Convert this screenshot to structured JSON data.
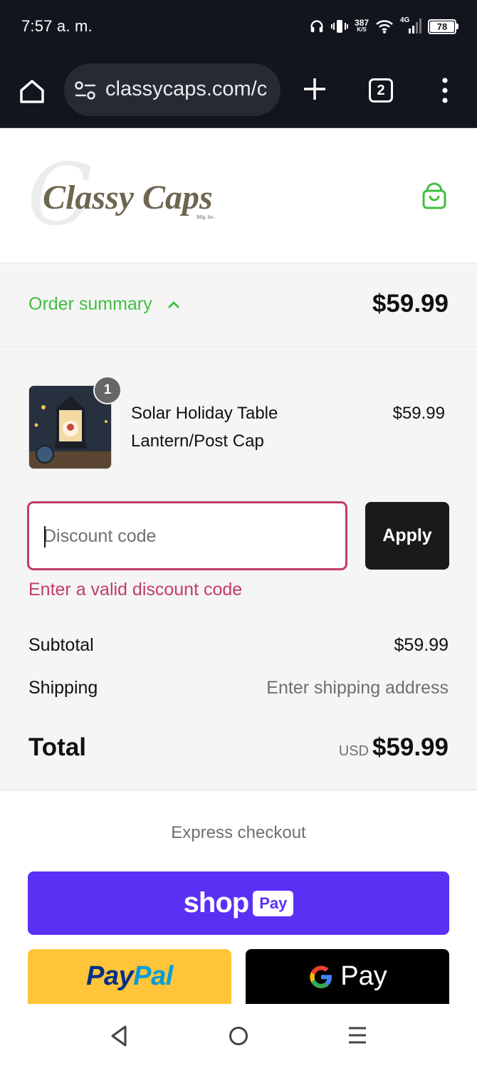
{
  "status_bar": {
    "time": "7:57 a. m.",
    "net_speed_value": "387",
    "net_speed_unit": "K/S",
    "network_type": "4G",
    "battery": "78"
  },
  "browser": {
    "url": "classycaps.com/c",
    "tab_count": "2"
  },
  "header": {
    "logo_text": "Classy Caps",
    "logo_subtext": "Mfg. Inc."
  },
  "summary": {
    "toggle_label": "Order summary",
    "toggle_total": "$59.99",
    "item": {
      "name": "Solar Holiday Table Lantern/Post Cap",
      "price": "$59.99",
      "quantity": "1"
    },
    "discount": {
      "placeholder": "Discount code",
      "apply_label": "Apply",
      "error": "Enter a valid discount code"
    },
    "subtotal_label": "Subtotal",
    "subtotal_value": "$59.99",
    "shipping_label": "Shipping",
    "shipping_value": "Enter shipping address",
    "total_label": "Total",
    "total_currency": "USD",
    "total_value": "$59.99"
  },
  "express": {
    "label": "Express checkout",
    "shop_word": "shop",
    "shop_pay": "Pay",
    "paypal_part1": "Pay",
    "paypal_part2": "Pal",
    "gpay_label": "Pay"
  },
  "colors": {
    "accent_green": "#3fbf3f",
    "error": "#c23b6a",
    "shop_pay_purple": "#5a31f4",
    "paypal_yellow": "#ffc439"
  }
}
